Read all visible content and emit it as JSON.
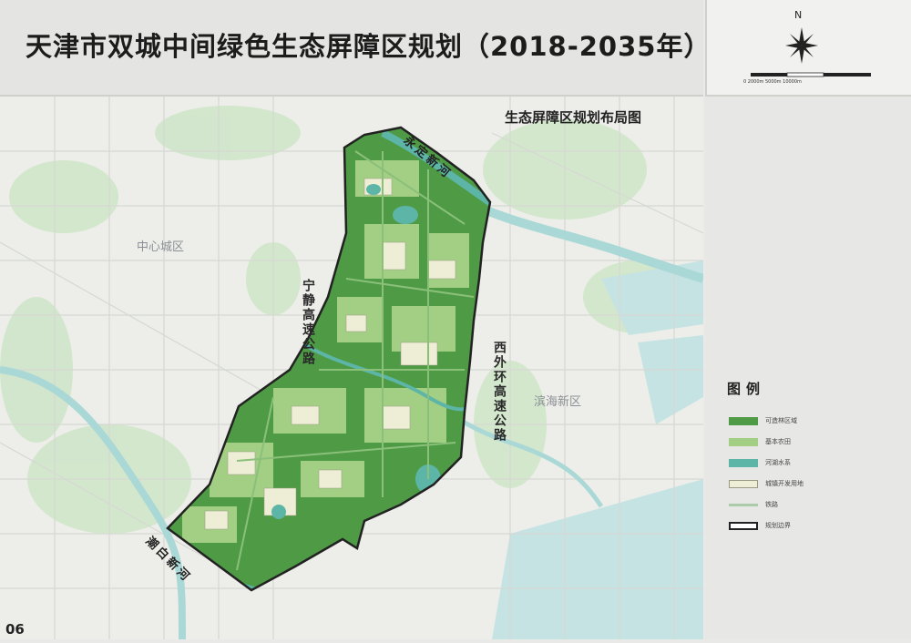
{
  "header": {
    "title": "天津市双城中间绿色生态屏障区规划（2018-2035年）"
  },
  "compass": {
    "north_label": "N",
    "scale_labels": "0    2000m    5000m         10000m"
  },
  "map": {
    "subtitle": "生态屏障区规划布局图",
    "zones": {
      "center_city": "中心城区",
      "binhai": "滨海新区"
    },
    "roads": {
      "ningjing": "宁静高速公路",
      "xiwaihuan": "西外环高速公路"
    },
    "rivers": {
      "yongding": "永定新河",
      "chaobai": "潮白新河"
    }
  },
  "legend": {
    "title": "图例",
    "items": [
      {
        "label": "可造林区域",
        "color": "#4e9a45",
        "border": "#4e9a45"
      },
      {
        "label": "基本农田",
        "color": "#a3cf84",
        "border": "#a3cf84"
      },
      {
        "label": "河湖水系",
        "color": "#5cb5a6",
        "border": "#5cb5a6"
      },
      {
        "label": "城镇开发用地",
        "color": "#eeeed7",
        "border": "#9a9a86"
      },
      {
        "label": "铁路",
        "color": "#aaccaa",
        "border": "#aaccaa"
      },
      {
        "label": "规划边界",
        "color": "#ffffff",
        "border": "#222222"
      }
    ]
  },
  "colors": {
    "forest": "#4e9a45",
    "farmland": "#a3cf84",
    "water": "#5cb5a6",
    "urban": "#eeeed7",
    "boundary": "#222222"
  },
  "footer": {
    "page_number": "06"
  }
}
